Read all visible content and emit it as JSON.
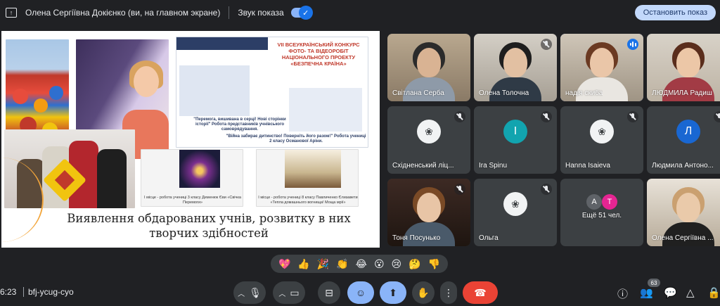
{
  "topbar": {
    "presenter": "Олена Сергіївна Докієнко (ви, на главном экране)",
    "sound_label": "Звук показа",
    "toggle_on": true,
    "stop_label": "Остановить показ"
  },
  "slide": {
    "poster_title": "VII ВСЕУКРАЇНСЬКИЙ КОНКУРС ФОТО- ТА ВІДЕОРОБІТ НАЦІОНАЛЬНОГО ПРОЕКТУ «БЕЗПЕЧНА КРАЇНА»",
    "poster_caption1": "\"Перемога, вишивана в серці! Нові сторінки історії\" Робота представників учнівського самоврядування.",
    "poster_caption2": "\"Війна забирає дитинство! Поверніть його разом!\" Робота учениці 2 класу Османової Аріни.",
    "candle1_caption": "І місце - робота учениці 3 класу Деменюк Єви «Свічка Перемоги»",
    "candle2_caption": "І місце - робота учениці 8 класу Павличенко Єлизавети «Тепла домашнього вогнища! Моща мрії»",
    "title_line1": "Виявлення обдарованих учнів, розвитку в них",
    "title_line2": "творчих здібностей"
  },
  "participants": [
    {
      "name": "Світлана Серба",
      "muted": false,
      "type": "video"
    },
    {
      "name": "Олена Толочна",
      "muted": true,
      "type": "video"
    },
    {
      "name": "надія скиба",
      "muted": false,
      "speaking": true,
      "type": "video"
    },
    {
      "name": "ЛЮДМИЛА Радиш",
      "muted": false,
      "type": "video"
    },
    {
      "name": "Східненський ліц...",
      "muted": true,
      "type": "avatar"
    },
    {
      "name": "Ira Spinu",
      "muted": true,
      "type": "avatar",
      "initial": "I",
      "color": "#12a4af"
    },
    {
      "name": "Hanna Isaieva",
      "muted": true,
      "type": "avatar"
    },
    {
      "name": "Людмила Антоно...",
      "muted": true,
      "type": "avatar",
      "initial": "Л",
      "color": "#1967d2"
    },
    {
      "name": "Тоня Посунько",
      "muted": true,
      "type": "video"
    },
    {
      "name": "Ольга",
      "muted": true,
      "type": "avatar"
    },
    {
      "name": "Ещё 51 чел.",
      "type": "more",
      "initials": [
        "А",
        "Т"
      ],
      "colors": [
        "#5f6368",
        "#e52592"
      ]
    },
    {
      "name": "Олена Сергіївна ...",
      "muted": false,
      "type": "video"
    }
  ],
  "reactions": [
    "💖",
    "👍",
    "🎉",
    "👏",
    "😂",
    "😮",
    "😢",
    "🤔",
    "👎"
  ],
  "bottombar": {
    "time": "6:23",
    "meeting_code": "bfj-ycug-cyo",
    "participants_count": "63"
  },
  "icons": {
    "share": "share-screen-icon",
    "mic": "mic-icon",
    "camera": "camera-icon",
    "captions": "captions-icon",
    "emoji": "emoji-icon",
    "present": "present-icon",
    "hand": "raise-hand-icon",
    "more": "more-vert-icon",
    "hangup": "hangup-icon",
    "info": "info-icon",
    "people": "people-icon",
    "chat": "chat-icon",
    "activities": "activities-icon",
    "lock": "host-controls-icon"
  },
  "colors": {
    "background": "#202124",
    "tile": "#3c4043",
    "accent": "#8ab4f8",
    "danger": "#ea4335"
  }
}
